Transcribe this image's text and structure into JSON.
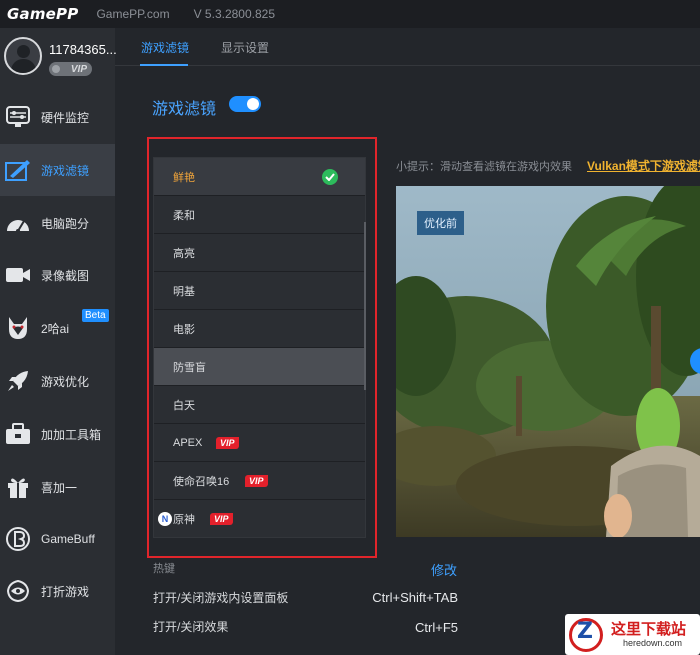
{
  "app": {
    "logo": "GamePP",
    "site": "GamePP.com",
    "version": "V 5.3.2800.825"
  },
  "profile": {
    "user_id": "11784365...",
    "vip_label": "VIP"
  },
  "sidebar": {
    "items": [
      {
        "label": "硬件监控",
        "icon": "hardware-monitor-icon",
        "active": false
      },
      {
        "label": "游戏滤镜",
        "icon": "filter-icon",
        "active": true
      },
      {
        "label": "电脑跑分",
        "icon": "speedometer-icon",
        "active": false
      },
      {
        "label": "录像截图",
        "icon": "camera-icon",
        "active": false
      },
      {
        "label": "2哈ai",
        "icon": "husky-icon",
        "active": false,
        "badge": "Beta"
      },
      {
        "label": "游戏优化",
        "icon": "rocket-icon",
        "active": false
      },
      {
        "label": "加加工具箱",
        "icon": "toolbox-icon",
        "active": false
      },
      {
        "label": "喜加一",
        "icon": "gift-icon",
        "active": false
      },
      {
        "label": "GameBuff",
        "icon": "gamebuff-icon",
        "active": false
      },
      {
        "label": "打折游戏",
        "icon": "discount-icon",
        "active": false
      }
    ]
  },
  "tabs": [
    {
      "label": "游戏滤镜",
      "active": true
    },
    {
      "label": "显示设置",
      "active": false
    }
  ],
  "section": {
    "title": "游戏滤镜",
    "enabled": true
  },
  "filters": [
    {
      "label": "鲜艳",
      "active": true,
      "checked": true
    },
    {
      "label": "柔和"
    },
    {
      "label": "高亮"
    },
    {
      "label": "明基"
    },
    {
      "label": "电影"
    },
    {
      "label": "防雪盲",
      "selected": true
    },
    {
      "label": "白天"
    },
    {
      "label": "APEX",
      "vip": "VIP"
    },
    {
      "label": "使命召唤16",
      "vip": "VIP"
    },
    {
      "label": "原神",
      "vip": "VIP",
      "badge": "N"
    }
  ],
  "tip": {
    "text": "小提示：滑动查看滤镜在游戏内效果",
    "link": "Vulkan模式下游戏滤镜"
  },
  "preview": {
    "before_label": "优化前"
  },
  "hotkeys": {
    "header": "热键",
    "modify": "修改",
    "rows": [
      {
        "label": "打开/关闭游戏内设置面板",
        "key": "Ctrl+Shift+TAB"
      },
      {
        "label": "打开/关闭效果",
        "key": "Ctrl+F5"
      }
    ]
  },
  "watermark": {
    "logo_letter": "Z",
    "text": "这里下载站",
    "domain": "heredown.com"
  },
  "colors": {
    "accent": "#3ea0ff",
    "active_filter": "#f0a43a",
    "vip": "#e3202b",
    "check": "#2dbb5c",
    "highlight_frame": "#e1252b"
  }
}
